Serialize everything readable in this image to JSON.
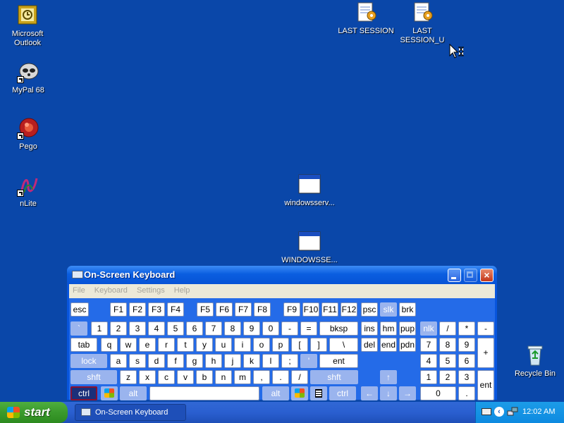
{
  "desktop": {
    "icons": [
      {
        "label": "Microsoft Outlook",
        "icon": "outlook-icon"
      },
      {
        "label": "MyPal 68",
        "icon": "mypal-icon"
      },
      {
        "label": "Pego",
        "icon": "pego-icon"
      },
      {
        "label": "nLite",
        "icon": "nlite-icon"
      },
      {
        "label": "LAST SESSION",
        "icon": "notepad-script-icon"
      },
      {
        "label": "LAST SESSION_U",
        "icon": "notepad-script-icon"
      },
      {
        "label": "windowsserv...",
        "icon": "window-app-icon"
      },
      {
        "label": "WINDOWSSE...",
        "icon": "window-app-icon"
      },
      {
        "label": "Recycle Bin",
        "icon": "recycle-bin-icon"
      }
    ]
  },
  "osk": {
    "title": "On-Screen Keyboard",
    "menu": [
      "File",
      "Keyboard",
      "Settings",
      "Help"
    ],
    "keys": {
      "esc": "esc",
      "f1": "F1",
      "f2": "F2",
      "f3": "F3",
      "f4": "F4",
      "f5": "F5",
      "f6": "F6",
      "f7": "F7",
      "f8": "F8",
      "f9": "F9",
      "f10": "F10",
      "f11": "F11",
      "f12": "F12",
      "psc": "psc",
      "slk": "slk",
      "brk": "brk",
      "backtick": "`",
      "n1": "1",
      "n2": "2",
      "n3": "3",
      "n4": "4",
      "n5": "5",
      "n6": "6",
      "n7": "7",
      "n8": "8",
      "n9": "9",
      "n0": "0",
      "minus": "-",
      "equals": "=",
      "bksp": "bksp",
      "ins": "ins",
      "hm": "hm",
      "pup": "pup",
      "nlk": "nlk",
      "slash": "/",
      "star": "*",
      "numminus": "-",
      "tab": "tab",
      "q": "q",
      "w": "w",
      "e": "e",
      "r": "r",
      "t": "t",
      "y": "y",
      "u": "u",
      "i": "i",
      "o": "o",
      "p": "p",
      "lbracket": "[",
      "rbracket": "]",
      "backslash": "\\",
      "del": "del",
      "end": "end",
      "pdn": "pdn",
      "np7": "7",
      "np8": "8",
      "np9": "9",
      "plus": "+",
      "lock": "lock",
      "a": "a",
      "s": "s",
      "d": "d",
      "f": "f",
      "g": "g",
      "h": "h",
      "j": "j",
      "k": "k",
      "l": "l",
      "semicolon": ";",
      "quote": "'",
      "ent": "ent",
      "np4": "4",
      "np5": "5",
      "np6": "6",
      "lshft": "shft",
      "z": "z",
      "x": "x",
      "c": "c",
      "v": "v",
      "b": "b",
      "n": "n",
      "m": "m",
      "comma": ",",
      "period": ".",
      "fslash": "/",
      "rshft": "shft",
      "up": "↑",
      "np1": "1",
      "np2": "2",
      "np3": "3",
      "npent": "ent",
      "lctrl": "ctrl",
      "lalt": "alt",
      "ralt": "alt",
      "rctrl": "ctrl",
      "left": "←",
      "down": "↓",
      "right": "→",
      "np0": "0",
      "npdot": "."
    }
  },
  "taskbar": {
    "start_label": "start",
    "task_label": "On-Screen Keyboard",
    "tray_chevron": "‹",
    "clock": "12:02 AM"
  }
}
